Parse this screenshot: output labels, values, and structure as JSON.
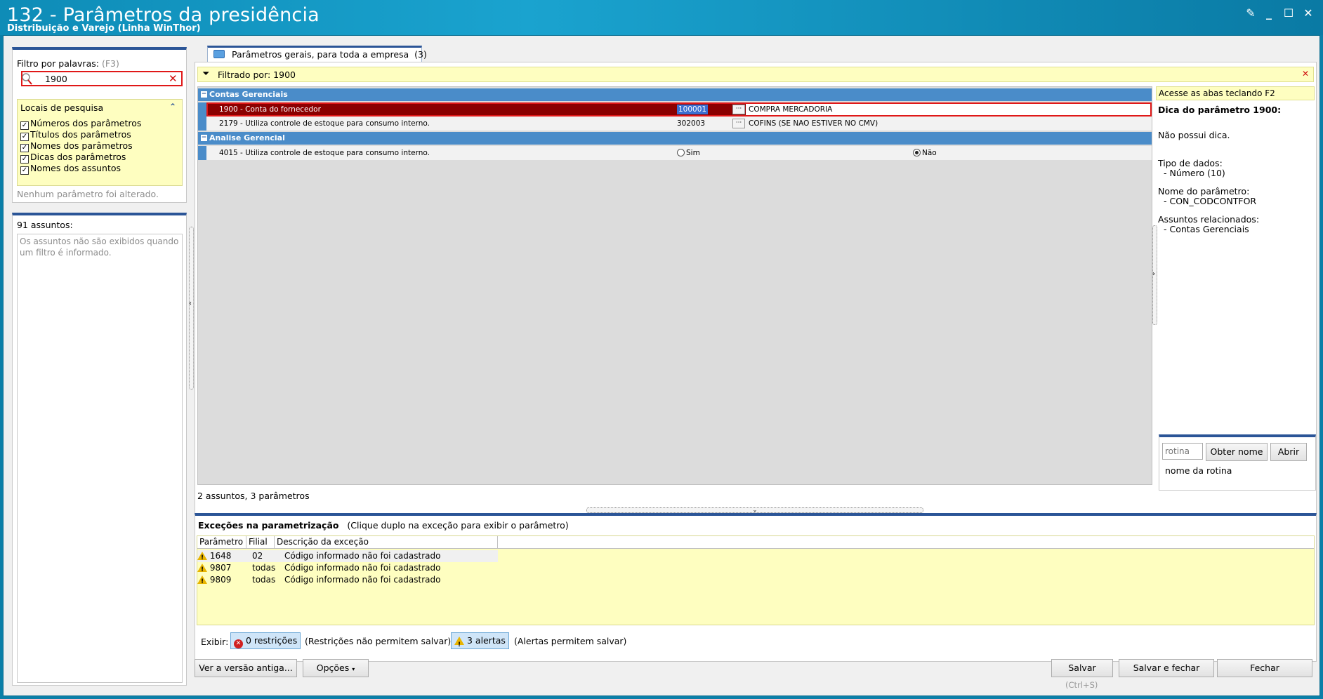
{
  "window": {
    "title": "132 - Parâmetros da presidência",
    "subtitle": "Distribuição e Varejo (Linha WinThor)"
  },
  "filter": {
    "label": "Filtro por palavras:",
    "shortcut": "(F3)",
    "search_value": "1900",
    "locais_title": "Locais de pesquisa",
    "options": [
      {
        "label": "Números dos parâmetros",
        "checked": true
      },
      {
        "label": "Títulos dos parâmetros",
        "checked": true
      },
      {
        "label": "Nomes dos parâmetros",
        "checked": true
      },
      {
        "label": "Dicas dos parâmetros",
        "checked": true
      },
      {
        "label": "Nomes dos assuntos",
        "checked": true
      }
    ],
    "status": "Nenhum parâmetro foi alterado."
  },
  "assuntos": {
    "count": "91 assuntos:",
    "message": "Os assuntos não são exibidos quando um filtro é informado."
  },
  "tab": {
    "label": "Parâmetros gerais, para toda a empresa",
    "count": "(3)"
  },
  "filter_bar": {
    "text": "Filtrado por: 1900"
  },
  "grid": {
    "groups": [
      {
        "label": "Contas Gerenciais"
      },
      {
        "label": "Analise Gerencial"
      }
    ],
    "rows": [
      {
        "name": "1900 - Conta do fornecedor",
        "value": "100001",
        "desc": "COMPRA MERCADORIA"
      },
      {
        "name": "2179 - Utiliza controle de estoque para consumo interno.",
        "value": "302003",
        "desc": "COFINS (SE NAO ESTIVER NO CMV)"
      },
      {
        "name": "4015 - Utiliza controle de estoque para consumo interno.",
        "radio_sim": "Sim",
        "radio_nao": "Não",
        "selected": "Não"
      }
    ],
    "status": "2 assuntos, 3 parâmetros"
  },
  "tip": {
    "hint": "Acesse as abas teclando F2",
    "title": "Dica do parâmetro 1900:",
    "no_tip": "Não possui dica.",
    "tipo_label": "Tipo de dados:",
    "tipo_value": "- Número (10)",
    "nome_label": "Nome do parâmetro:",
    "nome_value": "- CON_CODCONTFOR",
    "assuntos_label": "Assuntos relacionados:",
    "assuntos_value": "- Contas Gerenciais"
  },
  "rotina": {
    "placeholder": "rotina",
    "obter_label": "Obter nome",
    "abrir_label": "Abrir",
    "name_label": "nome da rotina"
  },
  "exceptions": {
    "title": "Exceções na parametrização",
    "subtitle": "(Clique duplo na exceção para exibir o parâmetro)",
    "headers": [
      "Parâmetro",
      "Filial",
      "Descrição da exceção"
    ],
    "rows": [
      {
        "param": "1648",
        "filial": "02",
        "desc": "Código informado não foi cadastrado"
      },
      {
        "param": "9807",
        "filial": "todas",
        "desc": "Código informado não foi cadastrado"
      },
      {
        "param": "9809",
        "filial": "todas",
        "desc": "Código informado não foi cadastrado"
      }
    ],
    "exibir_label": "Exibir:",
    "restricoes_chip": "0 restrições",
    "restricoes_note": "(Restrições não permitem salvar)",
    "alertas_chip": "3 alertas",
    "alertas_note": "(Alertas permitem salvar)"
  },
  "buttons": {
    "ver_label": "Ver a versão antiga...",
    "opcoes_label": "Opções",
    "salvar_label": "Salvar",
    "salvar_shortcut": "(Ctrl+S)",
    "salvar_fechar_label": "Salvar e fechar",
    "fechar_label": "Fechar"
  }
}
